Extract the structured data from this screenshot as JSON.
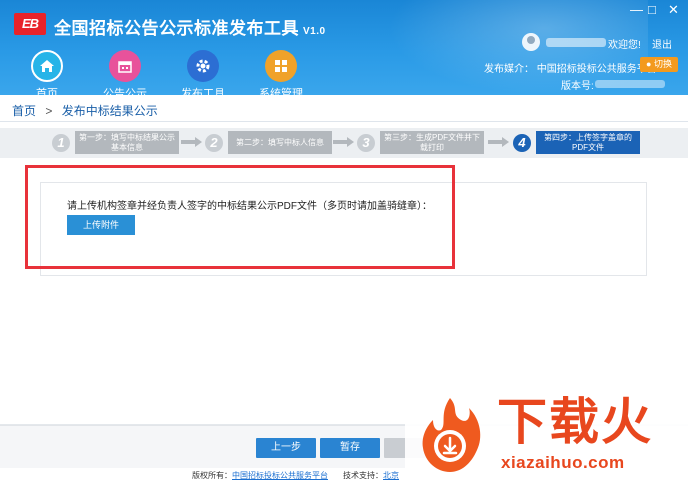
{
  "app": {
    "logo_text": "EB",
    "title": "全国招标公告公示标准发布工具",
    "version": "V1.0"
  },
  "window": {
    "minimize": "—",
    "maximize": "□",
    "close": "✕"
  },
  "nav": [
    {
      "label": "首页",
      "icon": "home-icon"
    },
    {
      "label": "公告公示",
      "icon": "calendar-icon"
    },
    {
      "label": "发布工具",
      "icon": "gear-icon"
    },
    {
      "label": "系统管理",
      "icon": "puzzle-icon"
    }
  ],
  "user": {
    "welcome": "欢迎您!",
    "logout": "退出",
    "media": "发布媒介： 中国招标投标公共服务平台",
    "switch": "● 切换",
    "version_label": "版本号:"
  },
  "breadcrumb": {
    "home": "首页",
    "sep": ">",
    "current": "发布中标结果公示"
  },
  "steps": [
    {
      "num": "1",
      "label": "第一步：填写中标结果公示基本信息"
    },
    {
      "num": "2",
      "label": "第二步：填写中标人信息"
    },
    {
      "num": "3",
      "label": "第三步：生成PDF文件并下载打印"
    },
    {
      "num": "4",
      "label": "第四步：上传签字盖章的PDF文件"
    }
  ],
  "content": {
    "instruction": "请上传机构签章并经负责人签字的中标结果公示PDF文件（多页时请加盖骑缝章）：",
    "upload_button": "上传附件"
  },
  "buttons": {
    "prev": "上一步",
    "save": "暂存",
    "next": ""
  },
  "footer": {
    "owner_label": "版权所有：",
    "owner": "中国招标投标公共服务平台",
    "tech_label": "技术支持：",
    "tech": "北京"
  },
  "watermark": {
    "brand": "下载火",
    "domain": "xiazaihuo.com"
  },
  "colors": {
    "header": "#1a86d6",
    "accent": "#1b63b6",
    "highlight": "#e8323a",
    "watermark": "#e8471e"
  }
}
